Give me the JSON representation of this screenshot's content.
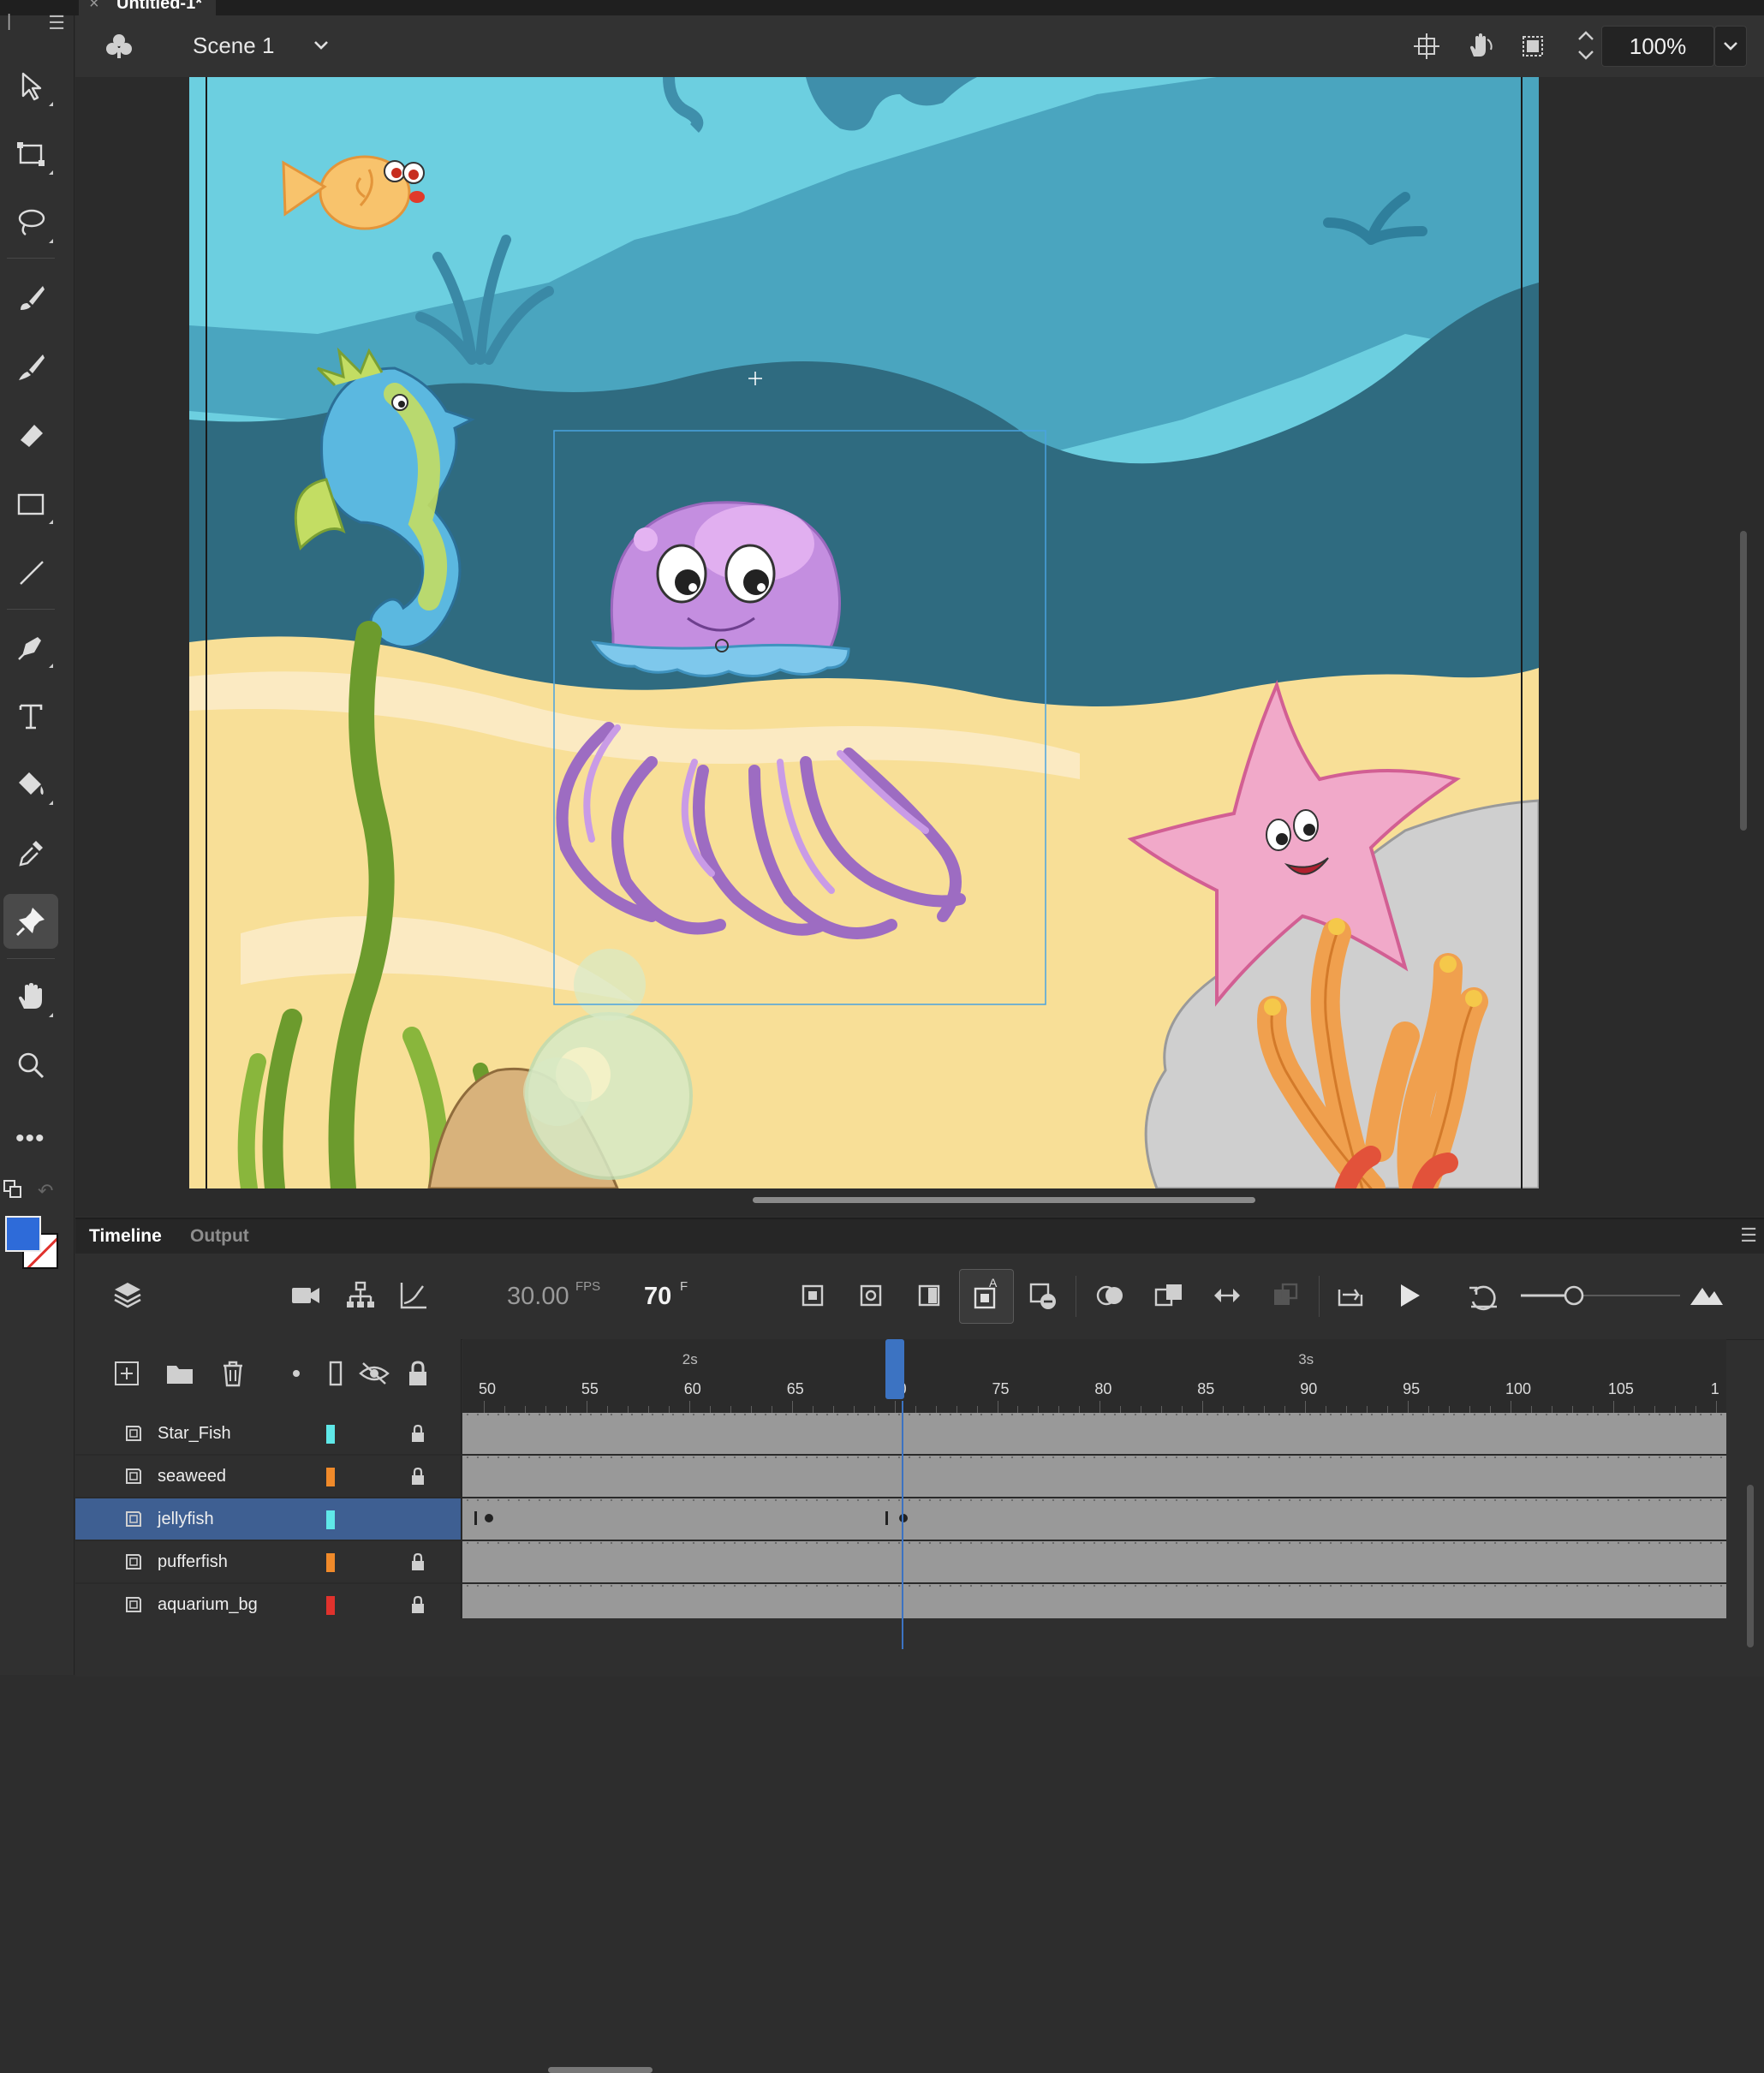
{
  "document": {
    "tab_close": "×",
    "tab_title": "Untitled-1*"
  },
  "toolbar": {
    "tools": [
      {
        "name": "selection-tool",
        "icon": "arrow-icon"
      },
      {
        "name": "free-transform-tool",
        "icon": "transform-icon"
      },
      {
        "name": "lasso-tool",
        "icon": "lasso-icon"
      },
      {
        "name": "paint-brush-tool",
        "icon": "paint-brush-icon"
      },
      {
        "name": "brush-tool",
        "icon": "brush-icon"
      },
      {
        "name": "eraser-tool",
        "icon": "eraser-icon"
      },
      {
        "name": "rectangle-tool",
        "icon": "rectangle-icon"
      },
      {
        "name": "line-tool",
        "icon": "line-icon"
      },
      {
        "name": "pen-tool",
        "icon": "pen-icon"
      },
      {
        "name": "text-tool",
        "icon": "text-icon"
      },
      {
        "name": "paint-bucket-tool",
        "icon": "bucket-icon"
      },
      {
        "name": "eyedropper-tool",
        "icon": "eyedropper-icon"
      },
      {
        "name": "asset-warp-tool",
        "icon": "pin-icon",
        "active": true
      },
      {
        "name": "hand-tool",
        "icon": "hand-icon"
      },
      {
        "name": "zoom-tool",
        "icon": "magnifier-icon"
      }
    ],
    "more_label": "•••",
    "fill_color": "#2e6bd9",
    "stroke_color": "#ffffff"
  },
  "editbar": {
    "scene_name": "Scene 1",
    "zoom": "100%"
  },
  "timeline": {
    "tabs": [
      {
        "label": "Timeline",
        "active": true
      },
      {
        "label": "Output",
        "active": false
      }
    ],
    "fps": "30.00",
    "fps_unit": "FPS",
    "current_frame": "70",
    "frame_unit": "F",
    "ruler": {
      "numbers": [
        "50",
        "55",
        "60",
        "65",
        "70",
        "75",
        "80",
        "85",
        "90",
        "95",
        "100",
        "105",
        "1"
      ],
      "seconds": [
        "2s",
        "3s"
      ],
      "playhead_frame": 70
    },
    "layers": [
      {
        "name": "Star_Fish",
        "color": "#5fe8e8",
        "locked": true,
        "selected": false
      },
      {
        "name": "seaweed",
        "color": "#f08a2a",
        "locked": true,
        "selected": false
      },
      {
        "name": "jellyfish",
        "color": "#5fe8e8",
        "locked": false,
        "selected": true
      },
      {
        "name": "pufferfish",
        "color": "#f08a2a",
        "locked": true,
        "selected": false
      },
      {
        "name": "aquarium_bg",
        "color": "#e0322d",
        "locked": true,
        "selected": false
      }
    ]
  },
  "accent_color": "#3c73c2"
}
